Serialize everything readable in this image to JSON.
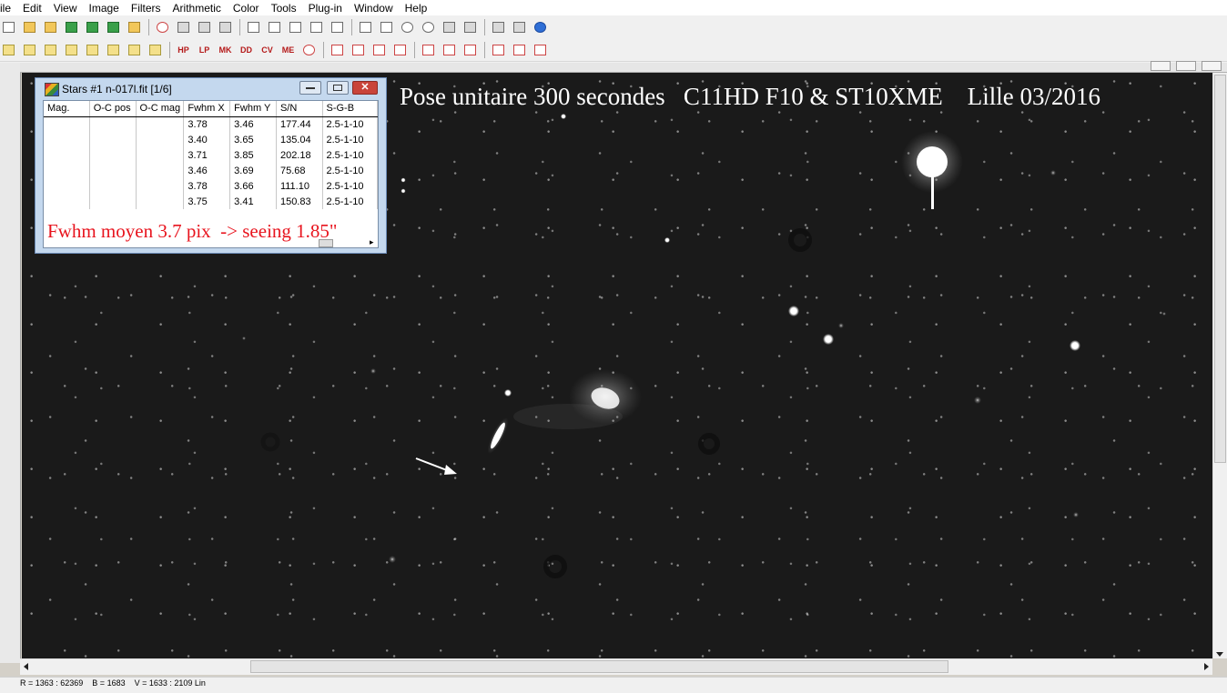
{
  "menubar": {
    "items": [
      "ile",
      "Edit",
      "View",
      "Image",
      "Filters",
      "Arithmetic",
      "Color",
      "Tools",
      "Plug-in",
      "Window",
      "Help"
    ]
  },
  "toolbar2": {
    "labels": [
      "HP",
      "LP",
      "MK",
      "DD",
      "CV",
      "ME"
    ]
  },
  "image": {
    "overlay_text": "Pose unitaire 300 secondes   C11HD F10 & ST10XME    Lille 03/2016"
  },
  "stars_window": {
    "title": "Stars #1 n-017l.fit  [1/6]",
    "columns": [
      "Mag.",
      "O-C pos",
      "O-C mag",
      "Fwhm X",
      "Fwhm Y",
      "S/N",
      "S-G-B"
    ],
    "rows": [
      [
        "",
        "",
        "",
        "3.78",
        "3.46",
        "177.44",
        "2.5-1-10"
      ],
      [
        "",
        "",
        "",
        "3.40",
        "3.65",
        "135.04",
        "2.5-1-10"
      ],
      [
        "",
        "",
        "",
        "3.71",
        "3.85",
        "202.18",
        "2.5-1-10"
      ],
      [
        "",
        "",
        "",
        "3.46",
        "3.69",
        "75.68",
        "2.5-1-10"
      ],
      [
        "",
        "",
        "",
        "3.78",
        "3.66",
        "111.10",
        "2.5-1-10"
      ],
      [
        "",
        "",
        "",
        "3.75",
        "3.41",
        "150.83",
        "2.5-1-10"
      ]
    ],
    "annotation": "Fwhm moyen 3.7 pix  -> seeing 1.85\""
  },
  "status": {
    "text": "R = 1363 : 62369    B = 1683    V = 1633 : 2109 Lin"
  },
  "colors": {
    "annotation_red": "#e8141e",
    "image_background": "#1a1a1a",
    "stars_window_frame": "#c4d8ee"
  }
}
